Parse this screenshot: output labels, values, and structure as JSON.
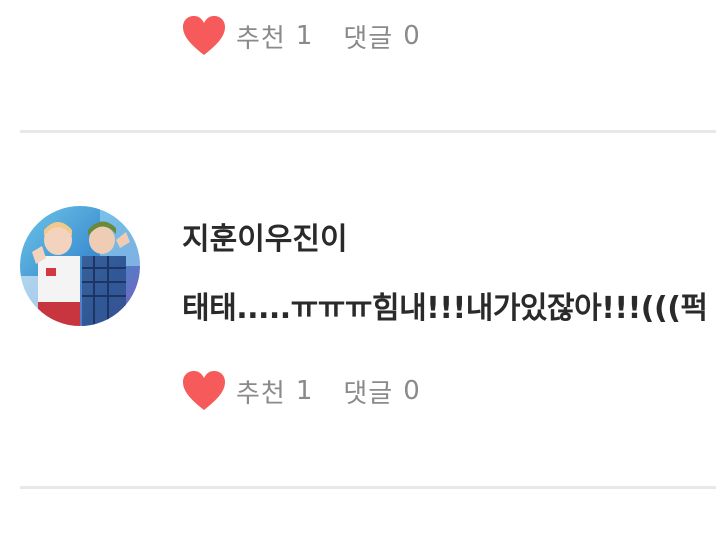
{
  "comments": [
    {
      "likes_label": "추천",
      "likes_count": "1",
      "replies_label": "댓글",
      "replies_count": "0"
    },
    {
      "username": "지훈이우진이",
      "text": "태태.....ㅠㅠㅠ힘내!!!내가있잖아!!!(((퍽",
      "likes_label": "추천",
      "likes_count": "1",
      "replies_label": "댓글",
      "replies_count": "0"
    }
  ],
  "colors": {
    "heart": "#f65a5a",
    "stat_text": "#8a8a8a",
    "divider": "#e8e8e8"
  },
  "icons": {
    "like": "heart-icon",
    "avatar": "user-avatar-photo"
  }
}
